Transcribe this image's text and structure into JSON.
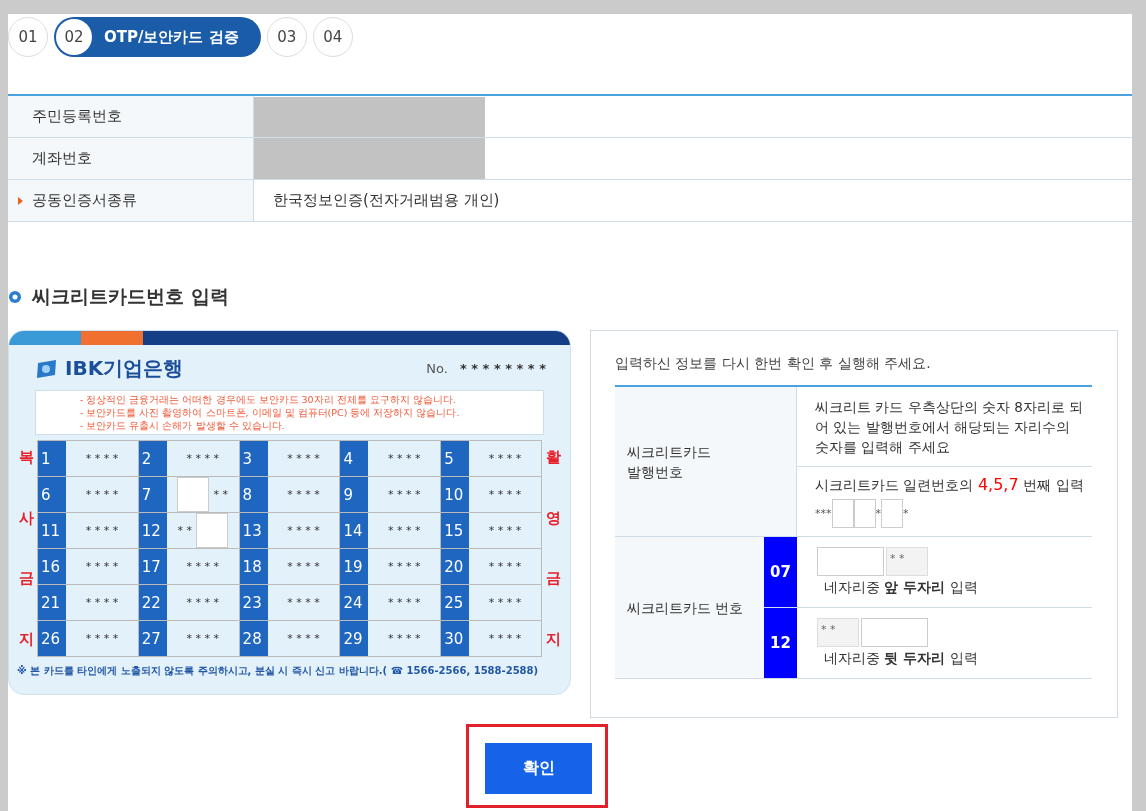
{
  "steps": [
    {
      "number": "01",
      "selected": false
    },
    {
      "number": "02",
      "label": "OTP/보안카드 검증",
      "selected": true
    },
    {
      "number": "03",
      "selected": false
    },
    {
      "number": "04",
      "selected": false
    }
  ],
  "info_rows": [
    {
      "label": "주민등록번호",
      "redacted": true,
      "marked": false
    },
    {
      "label": "계좌번호",
      "redacted": true,
      "marked": false
    },
    {
      "label": "공동인증서종류",
      "value": "한국정보인증(전자거래범용 개인)",
      "redacted": false,
      "marked": true
    }
  ],
  "section_title": "씨크리트카드번호 입력",
  "card": {
    "brand": "IBK기업은행",
    "serial_label": "No.",
    "serial": "* * * * * * * *",
    "notices": [
      "- 정상적인 금융거래는 어떠한 경우에도 보안카드 30자리 전체를 요구하지 않습니다.",
      "- 보안카드를 사진 촬영하여 스마트폰, 이메일 및 컴퓨터(PC) 등에 저장하지 않습니다.",
      "- 보안카드 유출시 손해가 발생할 수 있습니다."
    ],
    "side_left": [
      "복",
      "사",
      "금",
      "지"
    ],
    "side_right": [
      "활",
      "영",
      "금",
      "지"
    ],
    "cells": [
      {
        "num": "1",
        "kind": "full",
        "mask": "* * * *"
      },
      {
        "num": "2",
        "kind": "full",
        "mask": "* * * *"
      },
      {
        "num": "3",
        "kind": "full",
        "mask": "* * * *"
      },
      {
        "num": "4",
        "kind": "full",
        "mask": "* * * *"
      },
      {
        "num": "5",
        "kind": "full",
        "mask": "* * * *"
      },
      {
        "num": "6",
        "kind": "full",
        "mask": "* * * *"
      },
      {
        "num": "7",
        "kind": "blank_front",
        "mask": "* *"
      },
      {
        "num": "8",
        "kind": "full",
        "mask": "* * * *"
      },
      {
        "num": "9",
        "kind": "full",
        "mask": "* * * *"
      },
      {
        "num": "10",
        "kind": "full",
        "mask": "* * * *"
      },
      {
        "num": "11",
        "kind": "full",
        "mask": "* * * *"
      },
      {
        "num": "12",
        "kind": "blank_back",
        "mask": "* *"
      },
      {
        "num": "13",
        "kind": "full",
        "mask": "* * * *"
      },
      {
        "num": "14",
        "kind": "full",
        "mask": "* * * *"
      },
      {
        "num": "15",
        "kind": "full",
        "mask": "* * * *"
      },
      {
        "num": "16",
        "kind": "full",
        "mask": "* * * *"
      },
      {
        "num": "17",
        "kind": "full",
        "mask": "* * * *"
      },
      {
        "num": "18",
        "kind": "full",
        "mask": "* * * *"
      },
      {
        "num": "19",
        "kind": "full",
        "mask": "* * * *"
      },
      {
        "num": "20",
        "kind": "full",
        "mask": "* * * *"
      },
      {
        "num": "21",
        "kind": "full",
        "mask": "* * * *"
      },
      {
        "num": "22",
        "kind": "full",
        "mask": "* * * *"
      },
      {
        "num": "23",
        "kind": "full",
        "mask": "* * * *"
      },
      {
        "num": "24",
        "kind": "full",
        "mask": "* * * *"
      },
      {
        "num": "25",
        "kind": "full",
        "mask": "* * * *"
      },
      {
        "num": "26",
        "kind": "full",
        "mask": "* * * *"
      },
      {
        "num": "27",
        "kind": "full",
        "mask": "* * * *"
      },
      {
        "num": "28",
        "kind": "full",
        "mask": "* * * *"
      },
      {
        "num": "29",
        "kind": "full",
        "mask": "* * * *"
      },
      {
        "num": "30",
        "kind": "full",
        "mask": "* * * *"
      }
    ],
    "footer": "※ 본 카드를 타인에게 노출되지 않도록 주의하시고, 분실 시 즉시 신고 바랍니다.( ☎ 1566-2566, 1588-2588)"
  },
  "panel": {
    "notice": "입력하신 정보를 다시 한번 확인 후 실행해 주세요.",
    "issue": {
      "label_lines": [
        "씨크리트카드",
        "발행번호"
      ],
      "description": "씨크리트 카드 우측상단의 숫자 8자리로 되어 있는 발행번호에서 해당되는 자리수의 숫자를 입력해 주세요",
      "prompt_before": "시크리트카드 일련번호의",
      "prompt_digits": "4,5,7",
      "prompt_after": "번째 입력",
      "segments": [
        {
          "kind": "mask",
          "text": "***"
        },
        {
          "kind": "input"
        },
        {
          "kind": "input"
        },
        {
          "kind": "mask",
          "text": "*"
        },
        {
          "kind": "input"
        },
        {
          "kind": "mask",
          "text": "*"
        }
      ]
    },
    "number": {
      "label": "씨크리트카드 번호",
      "entries": [
        {
          "index": "07",
          "kind": "front",
          "mask": "* *",
          "hint": "네자리중 **앞 두자리** 입력"
        },
        {
          "index": "12",
          "kind": "back",
          "mask": "* *",
          "hint": "네자리중 **뒷 두자리** 입력"
        }
      ]
    }
  },
  "confirm": {
    "label": "확인",
    "highlighted": true
  }
}
